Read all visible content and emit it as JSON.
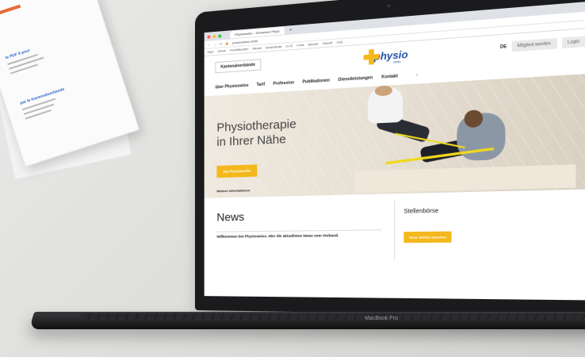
{
  "scene": {
    "laptop_label": "MacBook Pro"
  },
  "browser": {
    "tab_title": "Physioswiss – Schweizer Physi",
    "url": "physioswiss.ch/de",
    "bookmarks": [
      "Apps",
      "Schule",
      "Privat/Beruflich",
      "Steradl",
      "Social Media",
      "11:22",
      "Fonts",
      "Blender",
      "Zukunft",
      "CSS"
    ]
  },
  "site": {
    "kantonal_label": "Kantonalverbände",
    "logo_text": "physio",
    "logo_sub": "swiss",
    "lang": "DE",
    "member_button": "Mitglied werden",
    "login_button": "Login",
    "nav": [
      "über Physioswiss",
      "Tarif",
      "Profession",
      "Publikationen",
      "Dienstleistungen",
      "Kontakt"
    ],
    "hero": {
      "title_line1": "Physiotherapie",
      "title_line2": "in Ihrer Nähe",
      "cta": "Zur Praxissuche",
      "more": "Weitere Informationen"
    },
    "news": {
      "title": "News",
      "text": "Willkommen bei Physioswiss. Hier die aktuellsten News vom Verband."
    },
    "sidebar": {
      "title": "Stellenbörse",
      "button": "Neue Stellen ansehen"
    }
  },
  "paper": {
    "heading1": "le PDF 9 pour",
    "heading2": "par le Kantonalverbande"
  },
  "colors": {
    "accent_yellow": "#f4b81c",
    "brand_blue": "#1f4fa3"
  }
}
